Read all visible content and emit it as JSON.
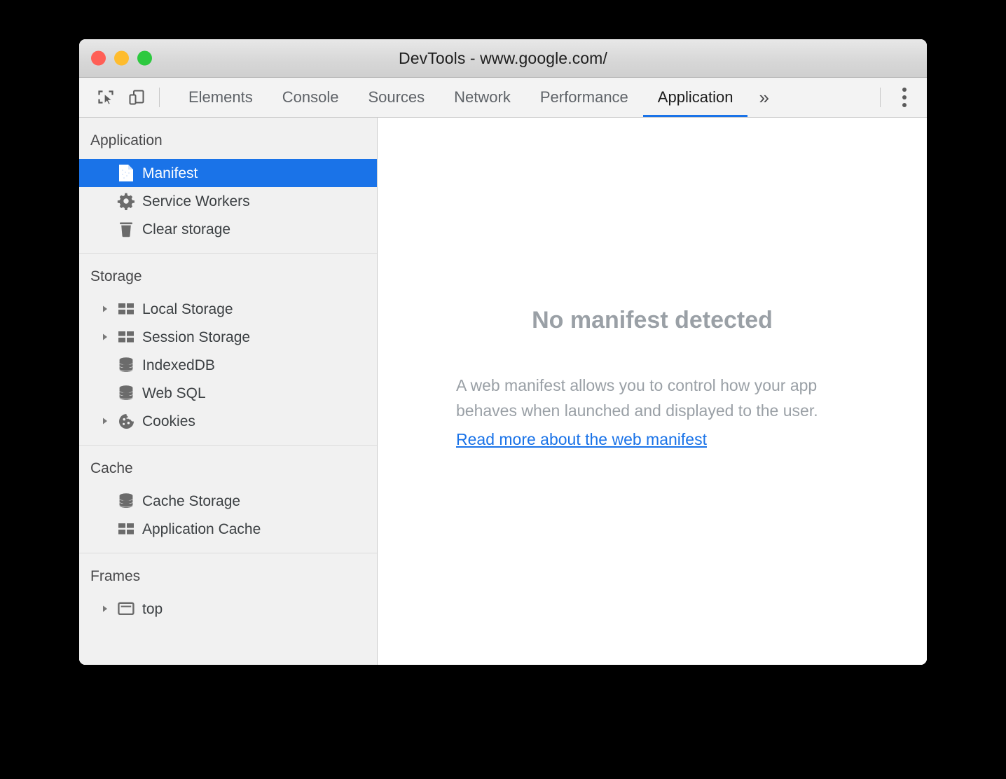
{
  "window": {
    "title": "DevTools - www.google.com/",
    "controls": [
      {
        "name": "close",
        "color": "#ff5f56"
      },
      {
        "name": "minimize",
        "color": "#febc2e"
      },
      {
        "name": "maximize",
        "color": "#2dc93f"
      }
    ]
  },
  "toolbar": {
    "inspect_icon": "inspect-element-icon",
    "device_icon": "device-toolbar-icon",
    "more_tabs_label": "»",
    "menu_icon": "kebab-menu-icon",
    "tabs": [
      {
        "label": "Elements",
        "active": false
      },
      {
        "label": "Console",
        "active": false
      },
      {
        "label": "Sources",
        "active": false
      },
      {
        "label": "Network",
        "active": false
      },
      {
        "label": "Performance",
        "active": false
      },
      {
        "label": "Application",
        "active": true
      }
    ]
  },
  "sidebar": {
    "sections": [
      {
        "title": "Application",
        "items": [
          {
            "label": "Manifest",
            "icon": "document-icon",
            "twisty": false,
            "selected": true
          },
          {
            "label": "Service Workers",
            "icon": "gear-icon",
            "twisty": false,
            "selected": false
          },
          {
            "label": "Clear storage",
            "icon": "trash-icon",
            "twisty": false,
            "selected": false
          }
        ]
      },
      {
        "title": "Storage",
        "items": [
          {
            "label": "Local Storage",
            "icon": "table-icon",
            "twisty": true,
            "selected": false
          },
          {
            "label": "Session Storage",
            "icon": "table-icon",
            "twisty": true,
            "selected": false
          },
          {
            "label": "IndexedDB",
            "icon": "database-icon",
            "twisty": false,
            "selected": false
          },
          {
            "label": "Web SQL",
            "icon": "database-icon",
            "twisty": false,
            "selected": false
          },
          {
            "label": "Cookies",
            "icon": "cookie-icon",
            "twisty": true,
            "selected": false
          }
        ]
      },
      {
        "title": "Cache",
        "items": [
          {
            "label": "Cache Storage",
            "icon": "database-icon",
            "twisty": false,
            "selected": false
          },
          {
            "label": "Application Cache",
            "icon": "table-icon",
            "twisty": false,
            "selected": false
          }
        ]
      },
      {
        "title": "Frames",
        "items": [
          {
            "label": "top",
            "icon": "frame-icon",
            "twisty": true,
            "selected": false
          }
        ]
      }
    ]
  },
  "main": {
    "empty_title": "No manifest detected",
    "empty_description": "A web manifest allows you to control how your app behaves when launched and displayed to the user.",
    "empty_link": "Read more about the web manifest"
  },
  "colors": {
    "accent": "#1a73e8",
    "sidebar_bg": "#f1f1f1",
    "muted_text": "#9aa0a6"
  }
}
